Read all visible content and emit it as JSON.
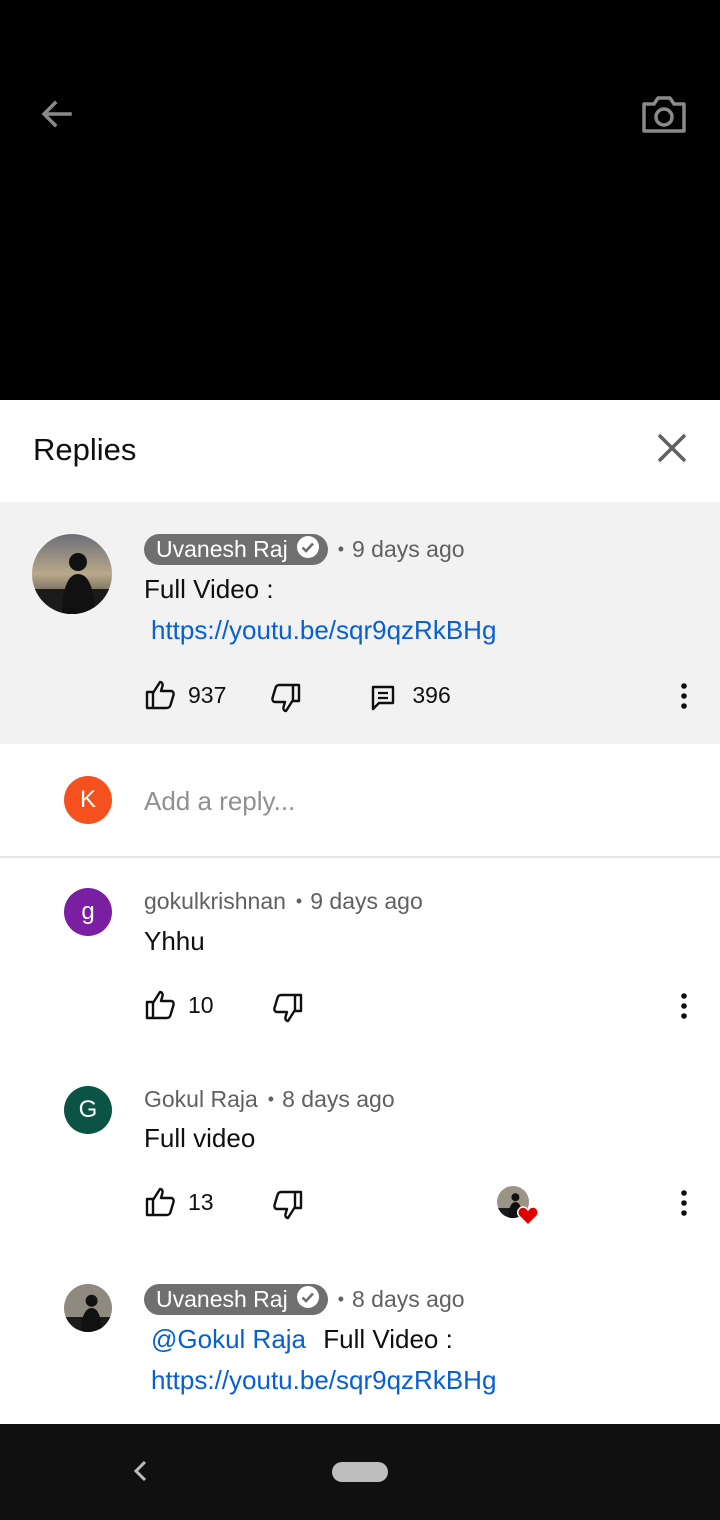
{
  "video": {
    "back_icon": "arrow-left-icon",
    "camera_icon": "camera-icon"
  },
  "sheet": {
    "title": "Replies",
    "close_icon": "close-icon"
  },
  "parent_comment": {
    "author": "Uvanesh Raj",
    "verified_icon": "check-circle-icon",
    "time": "9 days ago",
    "text": "Full Video :",
    "link": "https://youtu.be/sqr9qzRkBHg",
    "likes": "937",
    "replies": "396"
  },
  "reply_input": {
    "avatar_letter": "K",
    "placeholder": "Add a reply...",
    "avatar_color": "#f4511e"
  },
  "replies": [
    {
      "author": "gokulkrishnan",
      "time": "9 days ago",
      "text": "Yhhu",
      "likes": "10",
      "avatar_letter": "g",
      "avatar_color": "#7b1fa2"
    },
    {
      "author": "Gokul Raja",
      "time": "8 days ago",
      "text": "Full video",
      "likes": "13",
      "avatar_letter": "G",
      "avatar_color": "#0b5345",
      "creator_hearted": true
    },
    {
      "author": "Uvanesh Raj",
      "time": "8 days ago",
      "mention": "@Gokul Raja",
      "text": "Full Video :",
      "link": "https://youtu.be/sqr9qzRkBHg"
    }
  ],
  "nav": {
    "back_icon": "nav-back-icon",
    "home_icon": "home-pill"
  },
  "colors": {
    "link": "#065fd4",
    "heart": "#e00000",
    "pill": "#6f6f6f"
  }
}
